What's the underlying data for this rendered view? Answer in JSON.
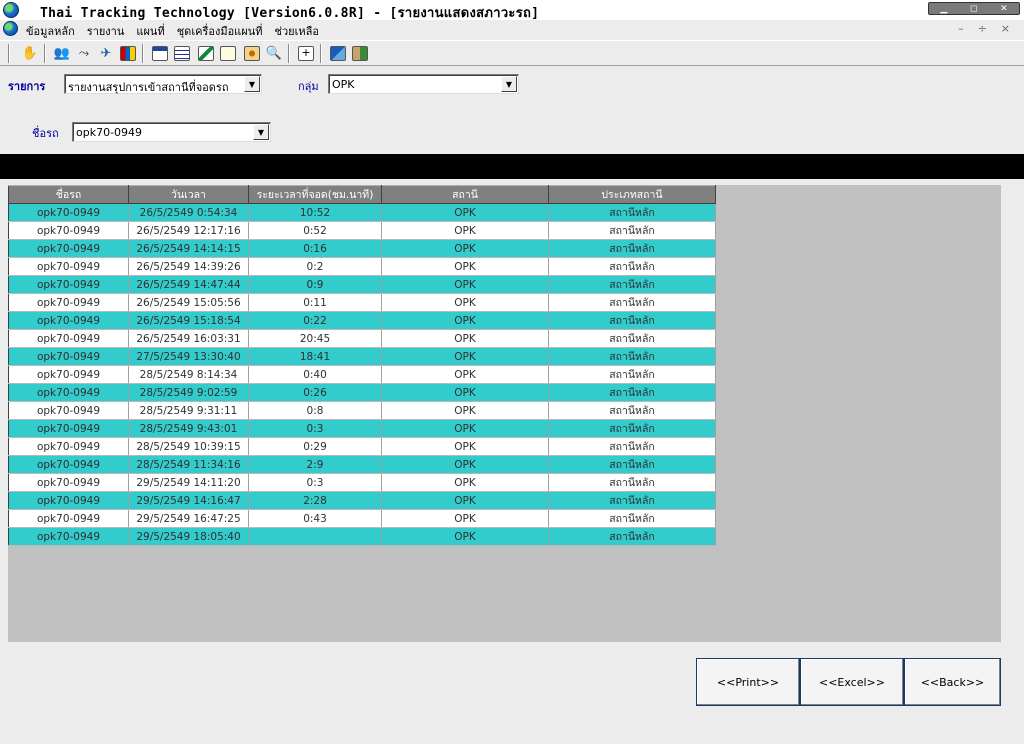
{
  "window": {
    "title": "Thai Tracking Technology [Version6.0.8R] - [รายงานแสดงสภาวะรถ]"
  },
  "menu": {
    "items": [
      "ข้อมูลหลัก",
      "รายงาน",
      "แผนที่",
      "ชุดเครื่องมือแผนที่",
      "ช่วยเหลือ"
    ]
  },
  "filters": {
    "report_label": "รายการ",
    "report_value": "รายงานสรุปการเข้าสถานีที่จอดรถ",
    "group_label": "กลุ่ม",
    "group_value": "OPK",
    "vehicle_label": "ชื่อรถ",
    "vehicle_value": "opk70-0949"
  },
  "table": {
    "columns": [
      "ชื่อรถ",
      "วันเวลา",
      "ระยะเวลาที่จอด(ชม.นาที)",
      "สถานี",
      "ประเภทสถานี"
    ],
    "rows": [
      [
        "opk70-0949",
        "26/5/2549 0:54:34",
        "10:52",
        "OPK",
        "สถานีหลัก"
      ],
      [
        "opk70-0949",
        "26/5/2549 12:17:16",
        "0:52",
        "OPK",
        "สถานีหลัก"
      ],
      [
        "opk70-0949",
        "26/5/2549 14:14:15",
        "0:16",
        "OPK",
        "สถานีหลัก"
      ],
      [
        "opk70-0949",
        "26/5/2549 14:39:26",
        "0:2",
        "OPK",
        "สถานีหลัก"
      ],
      [
        "opk70-0949",
        "26/5/2549 14:47:44",
        "0:9",
        "OPK",
        "สถานีหลัก"
      ],
      [
        "opk70-0949",
        "26/5/2549 15:05:56",
        "0:11",
        "OPK",
        "สถานีหลัก"
      ],
      [
        "opk70-0949",
        "26/5/2549 15:18:54",
        "0:22",
        "OPK",
        "สถานีหลัก"
      ],
      [
        "opk70-0949",
        "26/5/2549 16:03:31",
        "20:45",
        "OPK",
        "สถานีหลัก"
      ],
      [
        "opk70-0949",
        "27/5/2549 13:30:40",
        "18:41",
        "OPK",
        "สถานีหลัก"
      ],
      [
        "opk70-0949",
        "28/5/2549 8:14:34",
        "0:40",
        "OPK",
        "สถานีหลัก"
      ],
      [
        "opk70-0949",
        "28/5/2549 9:02:59",
        "0:26",
        "OPK",
        "สถานีหลัก"
      ],
      [
        "opk70-0949",
        "28/5/2549 9:31:11",
        "0:8",
        "OPK",
        "สถานีหลัก"
      ],
      [
        "opk70-0949",
        "28/5/2549 9:43:01",
        "0:3",
        "OPK",
        "สถานีหลัก"
      ],
      [
        "opk70-0949",
        "28/5/2549 10:39:15",
        "0:29",
        "OPK",
        "สถานีหลัก"
      ],
      [
        "opk70-0949",
        "28/5/2549 11:34:16",
        "2:9",
        "OPK",
        "สถานีหลัก"
      ],
      [
        "opk70-0949",
        "29/5/2549 14:11:20",
        "0:3",
        "OPK",
        "สถานีหลัก"
      ],
      [
        "opk70-0949",
        "29/5/2549 14:16:47",
        "2:28",
        "OPK",
        "สถานีหลัก"
      ],
      [
        "opk70-0949",
        "29/5/2549 16:47:25",
        "0:43",
        "OPK",
        "สถานีหลัก"
      ],
      [
        "opk70-0949",
        "29/5/2549 18:05:40",
        "",
        "OPK",
        "สถานีหลัก"
      ]
    ]
  },
  "buttons": {
    "print": "<<Print>>",
    "excel": "<<Excel>>",
    "back": "<<Back>>"
  },
  "colors": {
    "row_alt": "#33cccc",
    "row_norm": "#ffffff",
    "header_bg": "#808080",
    "label_blue": "#0000a0"
  },
  "toolbar_icons": [
    "hand-icon",
    "users-icon",
    "route-icon",
    "satellite-icon",
    "books-icon",
    "report-icon",
    "list-icon",
    "chart-icon",
    "document-icon",
    "camera-icon",
    "find-icon",
    "zoom-icon",
    "export-icon",
    "exit-icon"
  ]
}
